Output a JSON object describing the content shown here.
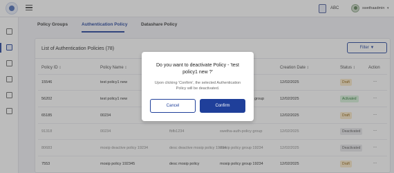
{
  "header": {
    "partner_label": "ABC",
    "username": "swethaadmin",
    "user_menu_chevron": "▾"
  },
  "tabs": [
    {
      "label": "Policy Groups"
    },
    {
      "label": "Authentication Policy"
    },
    {
      "label": "Datashare Policy"
    }
  ],
  "list": {
    "title": "List of Authentication Policies (78)",
    "filter_label": "Filter ▼"
  },
  "table": {
    "headers": [
      "Policy ID ↕",
      "Policy Name ↕",
      "Creation Date ↕",
      "Status ↕",
      "Action"
    ],
    "rows": [
      {
        "id": "15546",
        "name": "test policy1 new",
        "description": "",
        "group": "",
        "date": "12/02/2025",
        "status": "Draft",
        "action": "..."
      },
      {
        "id": "56202",
        "name": "test policy1 new",
        "description": "",
        "group": "group",
        "date": "12/02/2025",
        "status": "Activated",
        "action": "..."
      },
      {
        "id": "65185",
        "name": "00234",
        "description": "",
        "group": "",
        "date": "12/02/2025",
        "status": "Draft",
        "action": "..."
      },
      {
        "id": "91318",
        "name": "00234",
        "description": "fbfb1234",
        "group": "swetha-auth-policy group",
        "date": "12/02/2025",
        "status": "Deactivated",
        "action": "..."
      },
      {
        "id": "80683",
        "name": "mosip deactive policy 19234",
        "description": "desc deactive mosip policy 19234",
        "group": "mosip policy group 19234",
        "date": "12/02/2025",
        "status": "Deactivated",
        "action": "..."
      },
      {
        "id": "7553",
        "name": "mosip policy 192345",
        "description": "desc mosip policy",
        "group": "mosip policy group 19234",
        "date": "12/02/2025",
        "status": "Draft",
        "action": "..."
      }
    ]
  },
  "modal": {
    "title": "Do you want to deactivate Policy - 'test policy1 new ?'",
    "message": "Upon clicking 'Confirm', the selected Authentication Policy will be deactivated.",
    "cancel_label": "Cancel",
    "confirm_label": "Confirm"
  },
  "icons": {
    "logo": "logo-icon",
    "menu": "hamburger-icon",
    "partner": "partner-icon",
    "avatar": "avatar-icon"
  },
  "colors": {
    "primary": "#1f3f9a",
    "draft_bg": "#fbe9c7",
    "activated_bg": "#d6f0d8",
    "deactivated_bg": "#e7e7ea"
  }
}
